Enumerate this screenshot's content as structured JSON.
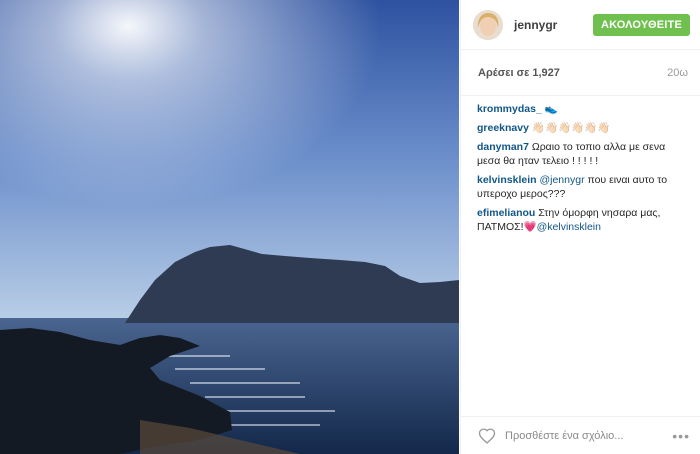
{
  "post": {
    "username": "jennygr",
    "follow_label": "ΑΚΟΛΟΥΘΕΙΤΕ",
    "likes_text": "Αρέσει σε 1,927",
    "time_ago": "20ω"
  },
  "comments": [
    {
      "user": "krommydas_",
      "text": " 👟",
      "mention": ""
    },
    {
      "user": "greeknavy",
      "text": " 👋🏻👋🏻👋🏻👋🏻👋🏻👋🏻",
      "mention": ""
    },
    {
      "user": "danyman7",
      "text": " Ωραιο το τοπιο αλλα με σενα μεσα θα ηταν τελειο ! ! ! ! !",
      "mention": ""
    },
    {
      "user": "kelvinsklein",
      "text": " που ειναι αυτο το υπεροχο μερος???",
      "mention": " @jennygr"
    },
    {
      "user": "efimelianou",
      "text": " Στην όμορφη νησαρα μας, ΠΑΤΜΟΣ!💗",
      "mention": "@kelvinsklein"
    }
  ],
  "footer": {
    "comment_placeholder": "Προσθέστε ένα σχόλιο...",
    "more_label": "•••"
  },
  "icons": {
    "like": "heart-icon",
    "more": "more-icon"
  },
  "colors": {
    "follow": "#70c050",
    "link": "#125688"
  }
}
